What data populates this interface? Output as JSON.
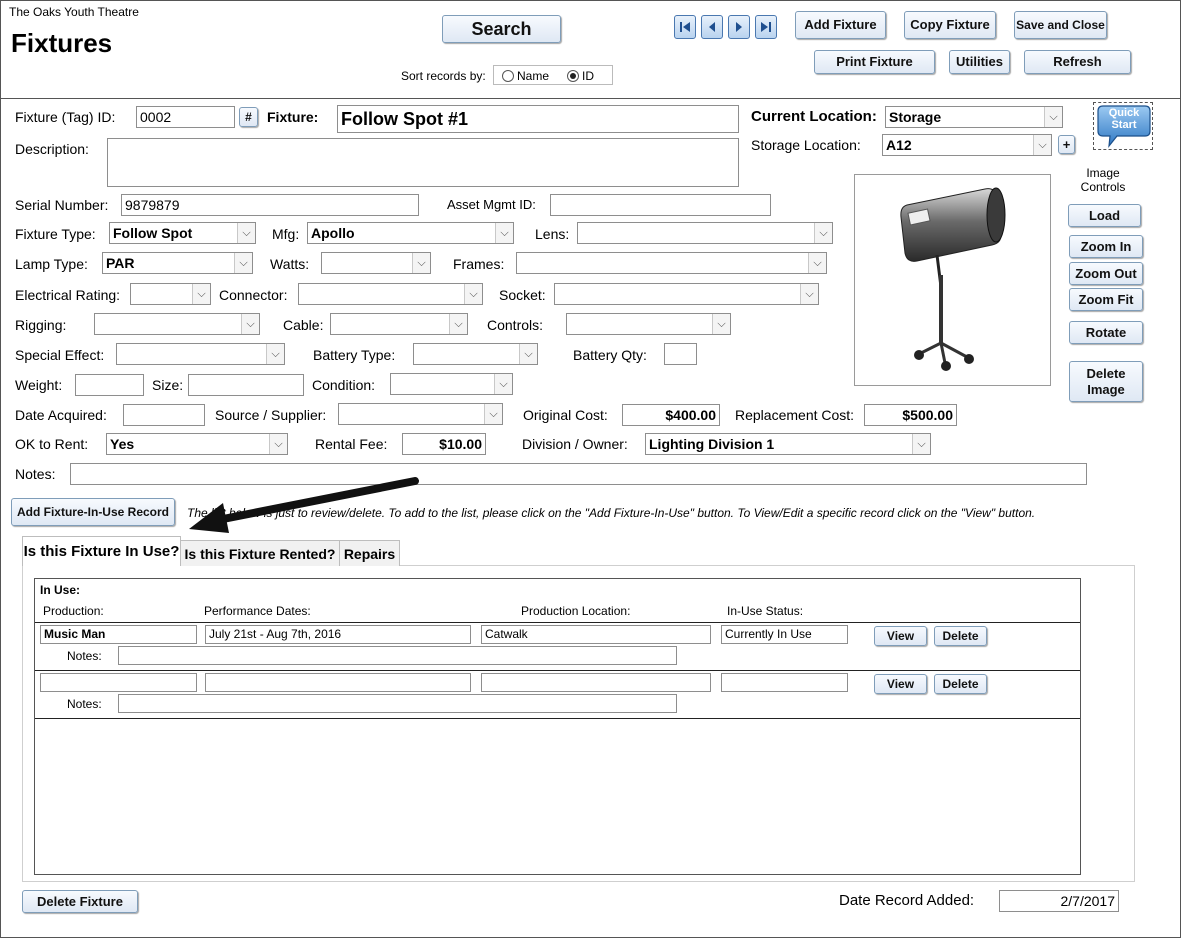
{
  "header": {
    "org_name": "The Oaks Youth Theatre",
    "form_title": "Fixtures",
    "search_label": "Search",
    "sort_label": "Sort records by:",
    "sort_option_name": "Name",
    "sort_option_id": "ID",
    "add_fixture": "Add Fixture",
    "copy_fixture": "Copy Fixture",
    "save_close": "Save and Close",
    "print_fixture": "Print Fixture",
    "utilities": "Utilities",
    "refresh": "Refresh"
  },
  "form": {
    "tag_id_label": "Fixture (Tag) ID:",
    "tag_id_value": "0002",
    "hash_btn": "#",
    "fixture_label": "Fixture:",
    "fixture_value": "Follow Spot #1",
    "description_label": "Description:",
    "current_location_label": "Current Location:",
    "current_location_value": "Storage",
    "storage_location_label": "Storage Location:",
    "storage_location_value": "A12",
    "plus_btn": "+",
    "quick_start": "Quick Start",
    "serial_label": "Serial Number:",
    "serial_value": "9879879",
    "asset_label": "Asset Mgmt ID:",
    "fixture_type_label": "Fixture Type:",
    "fixture_type_value": "Follow Spot",
    "mfg_label": "Mfg:",
    "mfg_value": "Apollo",
    "lens_label": "Lens:",
    "lamp_label": "Lamp Type:",
    "lamp_value": "PAR",
    "watts_label": "Watts:",
    "frames_label": "Frames:",
    "elec_label": "Electrical Rating:",
    "connector_label": "Connector:",
    "socket_label": "Socket:",
    "rigging_label": "Rigging:",
    "cable_label": "Cable:",
    "controls_label": "Controls:",
    "sfx_label": "Special Effect:",
    "battery_type_label": "Battery Type:",
    "battery_qty_label": "Battery Qty:",
    "weight_label": "Weight:",
    "size_label": "Size:",
    "condition_label": "Condition:",
    "date_acq_label": "Date Acquired:",
    "source_label": "Source / Supplier:",
    "orig_cost_label": "Original Cost:",
    "orig_cost_value": "$400.00",
    "repl_cost_label": "Replacement Cost:",
    "repl_cost_value": "$500.00",
    "ok_rent_label": "OK to Rent:",
    "ok_rent_value": "Yes",
    "rental_fee_label": "Rental Fee:",
    "rental_fee_value": "$10.00",
    "division_label": "Division / Owner:",
    "division_value": "Lighting Division 1",
    "notes_label": "Notes:"
  },
  "image_controls": {
    "title": "Image Controls",
    "load": "Load",
    "zoom_in": "Zoom In",
    "zoom_out": "Zoom Out",
    "zoom_fit": "Zoom Fit",
    "rotate": "Rotate",
    "delete_image": "Delete Image"
  },
  "inuse_section": {
    "add_btn": "Add Fixture-In-Use Record",
    "hint": "The list below is just to review/delete.  To add to the list, please click on the \"Add Fixture-In-Use\" button.  To View/Edit a specific record click on the \"View\" button.",
    "tabs": [
      "Is this Fixture In Use?",
      "Is this Fixture Rented?",
      "Repairs"
    ],
    "in_use_label": "In Use:",
    "col_production": "Production:",
    "col_dates": "Performance Dates:",
    "col_location": "Production Location:",
    "col_status": "In-Use Status:",
    "notes_label": "Notes:",
    "view_btn": "View",
    "delete_btn": "Delete",
    "rows": [
      {
        "production": "Music Man",
        "dates": "July 21st - Aug 7th, 2016",
        "location": "Catwalk",
        "status": "Currently In Use",
        "notes": ""
      },
      {
        "production": "",
        "dates": "",
        "location": "",
        "status": "",
        "notes": ""
      }
    ]
  },
  "footer": {
    "delete_fixture": "Delete Fixture",
    "date_added_label": "Date Record Added:",
    "date_added_value": "2/7/2017"
  }
}
